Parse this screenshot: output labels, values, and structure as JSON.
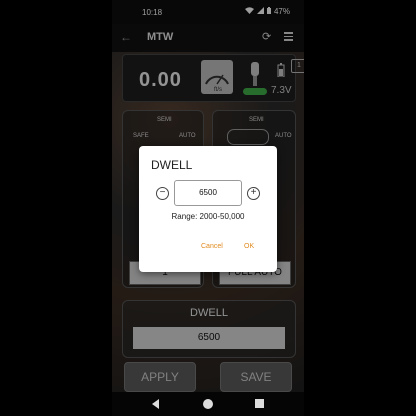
{
  "status": {
    "time": "10:18",
    "battery_pct": "47%"
  },
  "appbar": {
    "title": "MTW"
  },
  "display": {
    "speed": "0.00",
    "voltage": "7.3V",
    "count": "1"
  },
  "modes": {
    "left": {
      "top_label": "SEMI",
      "left_label": "SAFE",
      "right_label": "AUTO"
    },
    "right": {
      "top_label": "SEMI",
      "right_label": "AUTO"
    },
    "burst_value": "1",
    "full_auto_label": "FULL AUTO"
  },
  "dwell": {
    "label": "DWELL",
    "value": "6500"
  },
  "buttons": {
    "apply": "APPLY",
    "save": "SAVE"
  },
  "dialog": {
    "title": "DWELL",
    "input_value": "6500",
    "range_text": "Range: 2000-50,000",
    "cancel": "Cancel",
    "ok": "OK",
    "minus": "−",
    "plus": "+"
  },
  "colors": {
    "accent": "#e08a1e"
  }
}
